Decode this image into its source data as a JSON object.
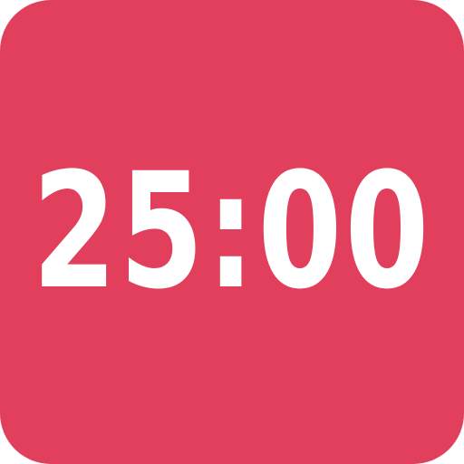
{
  "timer": {
    "display": "25:00"
  },
  "colors": {
    "background": "#E23F5C",
    "text": "#FFFFFF"
  }
}
